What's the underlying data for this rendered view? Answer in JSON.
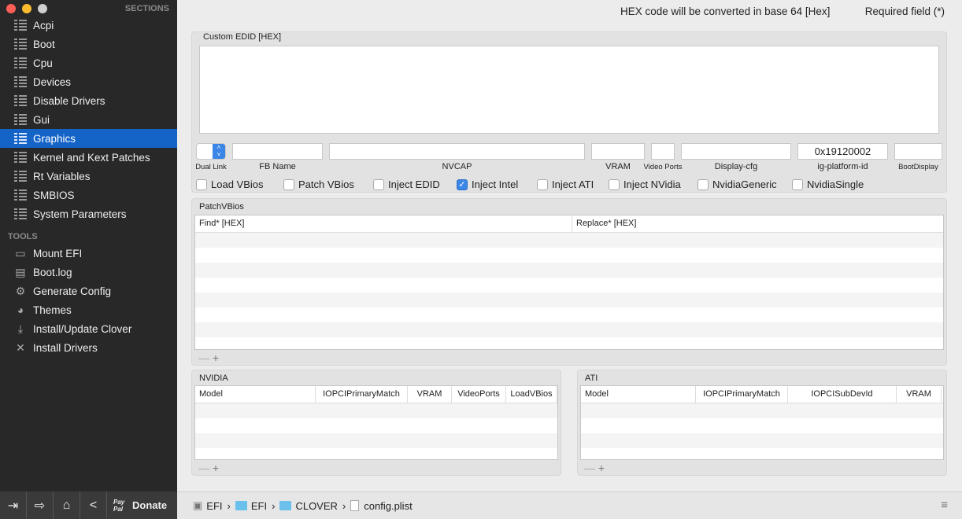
{
  "sidebar": {
    "sections_header": "SECTIONS",
    "items": [
      {
        "label": "Acpi"
      },
      {
        "label": "Boot"
      },
      {
        "label": "Cpu"
      },
      {
        "label": "Devices"
      },
      {
        "label": "Disable Drivers"
      },
      {
        "label": "Gui"
      },
      {
        "label": "Graphics",
        "selected": true
      },
      {
        "label": "Kernel and Kext Patches"
      },
      {
        "label": "Rt Variables"
      },
      {
        "label": "SMBIOS"
      },
      {
        "label": "System Parameters"
      }
    ],
    "tools_header": "TOOLS",
    "tools": [
      {
        "label": "Mount EFI",
        "icon": "disk-icon"
      },
      {
        "label": "Boot.log",
        "icon": "log-icon"
      },
      {
        "label": "Generate Config",
        "icon": "gear-icon"
      },
      {
        "label": "Themes",
        "icon": "palette-icon"
      },
      {
        "label": "Install/Update Clover",
        "icon": "download-icon"
      },
      {
        "label": "Install Drivers",
        "icon": "tools-icon"
      }
    ],
    "bottom": {
      "paypal": "Pay Pal",
      "donate": "Donate"
    }
  },
  "header": {
    "hex_note": "HEX code will be converted in base 64 [Hex]",
    "required_note": "Required field (*)"
  },
  "edid": {
    "label": "Custom EDID [HEX]",
    "value": ""
  },
  "fields": {
    "dual_link": "Dual Link",
    "fb_name": "FB Name",
    "nvcap": "NVCAP",
    "vram": "VRAM",
    "video_ports": "Video Ports",
    "display_cfg": "Display-cfg",
    "ig_platform_id": "ig-platform-id",
    "ig_platform_id_value": "0x19120002",
    "boot_display": "BootDisplay"
  },
  "checkboxes": [
    {
      "label": "Load VBios",
      "checked": false
    },
    {
      "label": "Patch VBios",
      "checked": false
    },
    {
      "label": "Inject EDID",
      "checked": false
    },
    {
      "label": "Inject Intel",
      "checked": true
    },
    {
      "label": "Inject ATI",
      "checked": false
    },
    {
      "label": "Inject NVidia",
      "checked": false
    },
    {
      "label": "NvidiaGeneric",
      "checked": false
    },
    {
      "label": "NvidiaSingle",
      "checked": false
    }
  ],
  "patchvbios": {
    "label": "PatchVBios",
    "columns": [
      "Find* [HEX]",
      "Replace* [HEX]"
    ]
  },
  "nvidia": {
    "label": "NVIDIA",
    "columns": [
      "Model",
      "IOPCIPrimaryMatch",
      "VRAM",
      "VideoPorts",
      "LoadVBios"
    ]
  },
  "ati": {
    "label": "ATI",
    "columns": [
      "Model",
      "IOPCIPrimaryMatch",
      "IOPCISubDevId",
      "VRAM"
    ]
  },
  "controls": {
    "minus": "—",
    "plus": "+"
  },
  "breadcrumb": [
    "EFI",
    "EFI",
    "CLOVER",
    "config.plist"
  ],
  "breadcrumb_sep": "›"
}
